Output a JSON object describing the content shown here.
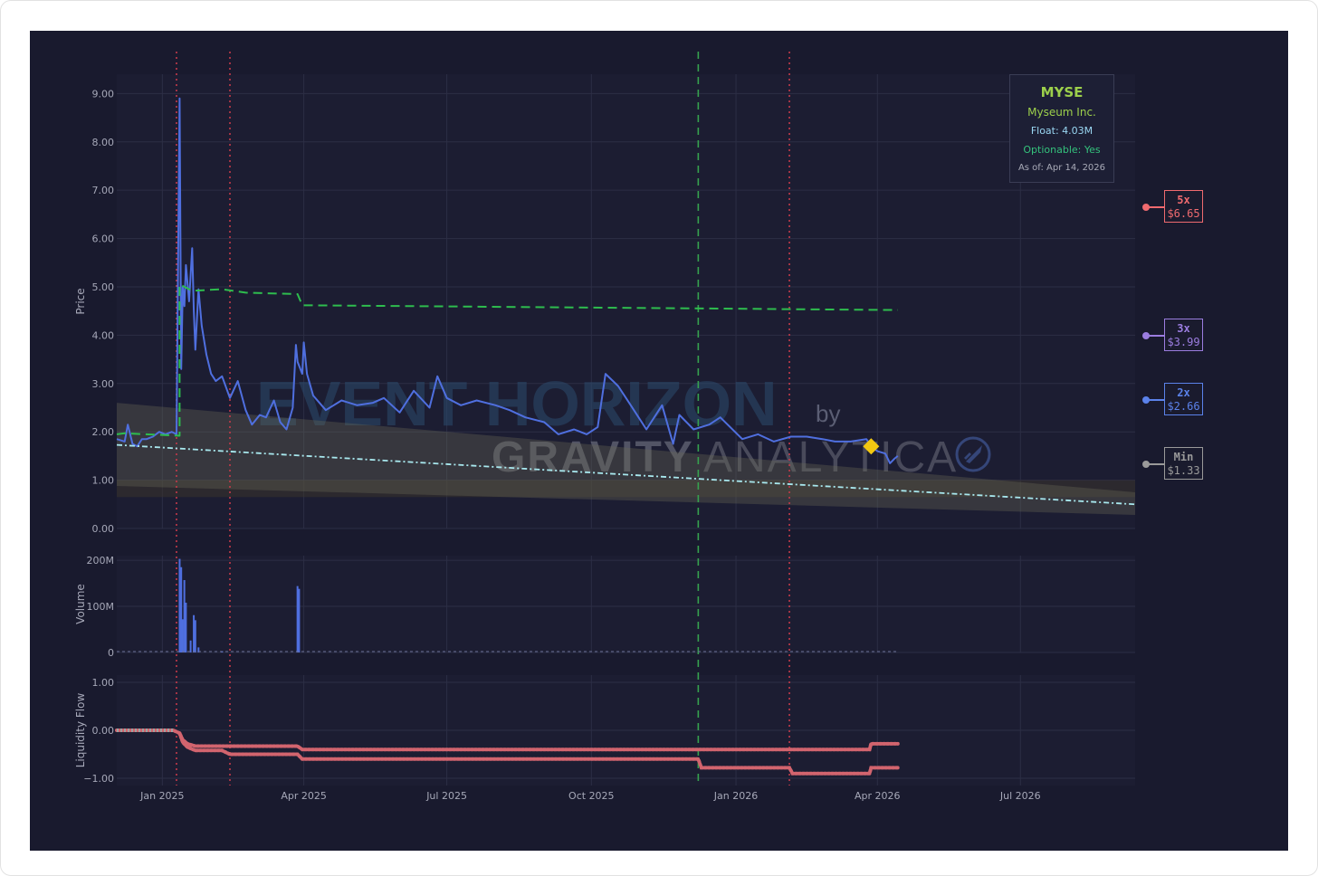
{
  "chart_data": {
    "type": "line",
    "ticker": "MYSE",
    "company": "Myseum Inc.",
    "float_text": "Float: 4.03M",
    "optionable_text": "Optionable: Yes",
    "as_of_text": "As of: Apr 14, 2026",
    "watermark": {
      "line1": "EVENT HORIZON",
      "by": "by",
      "line2a": "GRAVITY",
      "line2b": "ANALYTICA"
    },
    "x_ticks": [
      "Jan 2025",
      "Apr 2025",
      "Jul 2025",
      "Oct 2025",
      "Jan 2026",
      "Apr 2026",
      "Jul 2026"
    ],
    "x_tick_dates": [
      "2025-01-01",
      "2025-04-01",
      "2025-07-01",
      "2025-10-01",
      "2026-01-01",
      "2026-04-01",
      "2026-07-01"
    ],
    "x_range": [
      "2024-12-03",
      "2026-09-12"
    ],
    "panels": {
      "price": {
        "ylabel": "Price",
        "ylim": [
          0,
          9.4
        ],
        "y_ticks": [
          "0.00",
          "1.00",
          "2.00",
          "3.00",
          "4.00",
          "5.00",
          "6.00",
          "7.00",
          "8.00",
          "9.00"
        ],
        "series": [
          {
            "role": "price",
            "color": "#4f6fdf",
            "x": [
              "2024-12-03",
              "2024-12-08",
              "2024-12-10",
              "2024-12-13",
              "2024-12-16",
              "2024-12-19",
              "2024-12-22",
              "2024-12-26",
              "2024-12-30",
              "2025-01-03",
              "2025-01-07",
              "2025-01-10",
              "2025-01-12",
              "2025-01-13",
              "2025-01-14",
              "2025-01-15",
              "2025-01-16",
              "2025-01-18",
              "2025-01-20",
              "2025-01-21",
              "2025-01-22",
              "2025-01-24",
              "2025-01-26",
              "2025-01-29",
              "2025-02-01",
              "2025-02-04",
              "2025-02-08",
              "2025-02-13",
              "2025-02-18",
              "2025-02-23",
              "2025-02-27",
              "2025-03-04",
              "2025-03-08",
              "2025-03-13",
              "2025-03-17",
              "2025-03-21",
              "2025-03-25",
              "2025-03-27",
              "2025-03-28",
              "2025-03-31",
              "2025-04-01",
              "2025-04-03",
              "2025-04-07",
              "2025-04-15",
              "2025-04-25",
              "2025-05-05",
              "2025-05-15",
              "2025-05-22",
              "2025-06-01",
              "2025-06-10",
              "2025-06-20",
              "2025-06-25",
              "2025-07-01",
              "2025-07-10",
              "2025-07-20",
              "2025-08-01",
              "2025-08-10",
              "2025-08-20",
              "2025-09-01",
              "2025-09-10",
              "2025-09-20",
              "2025-09-28",
              "2025-10-05",
              "2025-10-10",
              "2025-10-18",
              "2025-10-25",
              "2025-11-05",
              "2025-11-15",
              "2025-11-22",
              "2025-11-26",
              "2025-12-05",
              "2025-12-15",
              "2025-12-22",
              "2026-01-05",
              "2026-01-15",
              "2026-01-25",
              "2026-02-05",
              "2026-02-15",
              "2026-02-25",
              "2026-03-05",
              "2026-03-15",
              "2026-03-25",
              "2026-03-28",
              "2026-04-01",
              "2026-04-06",
              "2026-04-09",
              "2026-04-12",
              "2026-04-14"
            ],
            "y": [
              1.85,
              1.8,
              2.15,
              1.75,
              1.7,
              1.85,
              1.85,
              1.9,
              2.0,
              1.95,
              2.0,
              1.95,
              8.9,
              3.3,
              5.0,
              4.6,
              5.45,
              4.7,
              5.8,
              4.5,
              3.7,
              4.95,
              4.2,
              3.6,
              3.2,
              3.05,
              3.15,
              2.7,
              3.05,
              2.45,
              2.15,
              2.35,
              2.3,
              2.65,
              2.2,
              2.05,
              2.5,
              3.8,
              3.45,
              3.2,
              3.85,
              3.2,
              2.75,
              2.45,
              2.65,
              2.55,
              2.6,
              2.7,
              2.4,
              2.85,
              2.5,
              3.15,
              2.7,
              2.55,
              2.65,
              2.55,
              2.45,
              2.3,
              2.2,
              1.95,
              2.05,
              1.95,
              2.1,
              3.2,
              2.95,
              2.6,
              2.05,
              2.55,
              1.75,
              2.35,
              2.05,
              2.15,
              2.3,
              1.85,
              1.95,
              1.8,
              1.9,
              1.9,
              1.85,
              1.8,
              1.8,
              1.85,
              1.7,
              1.6,
              1.55,
              1.35,
              1.45,
              1.5
            ]
          },
          {
            "role": "moving average",
            "color": "#2ebd4e",
            "x": [
              "2024-12-03",
              "2024-12-08",
              "2025-01-12",
              "2025-01-12",
              "2025-01-20",
              "2025-02-08",
              "2025-02-23",
              "2025-03-28",
              "2025-03-28",
              "2025-03-31",
              "2026-04-14"
            ],
            "y": [
              1.95,
              1.97,
              1.92,
              5.05,
              4.92,
              4.95,
              4.88,
              4.85,
              4.85,
              4.62,
              4.52
            ]
          },
          {
            "role": "trend",
            "color": "#a8e8ee",
            "x": [
              "2024-12-03",
              "2026-09-12"
            ],
            "y": [
              1.73,
              0.5
            ]
          }
        ],
        "band": {
          "color": "#6b6b55",
          "x": [
            "2024-12-03",
            "2026-09-12"
          ],
          "upper": [
            2.6,
            0.75
          ],
          "lower": [
            0.88,
            0.28
          ]
        },
        "horizontal_band": {
          "y": [
            0.65,
            1.0
          ],
          "color": "#3b362a"
        },
        "signal_marker": {
          "x": "2026-03-28",
          "y": 1.7,
          "color": "#f2c811",
          "shape": "diamond"
        }
      },
      "volume": {
        "ylabel": "Volume",
        "ylim": [
          0,
          210
        ],
        "y_ticks": [
          "0",
          "100M",
          "200M"
        ],
        "bars_millions": [
          {
            "x": "2025-01-12",
            "v": 203
          },
          {
            "x": "2025-01-13",
            "v": 185
          },
          {
            "x": "2025-01-14",
            "v": 72
          },
          {
            "x": "2025-01-15",
            "v": 157
          },
          {
            "x": "2025-01-16",
            "v": 108
          },
          {
            "x": "2025-01-19",
            "v": 26
          },
          {
            "x": "2025-01-21",
            "v": 81
          },
          {
            "x": "2025-01-22",
            "v": 70
          },
          {
            "x": "2025-01-24",
            "v": 11
          },
          {
            "x": "2025-02-08",
            "v": 3
          },
          {
            "x": "2025-03-28",
            "v": 144
          },
          {
            "x": "2025-03-29",
            "v": 138
          }
        ]
      },
      "liquidity": {
        "ylabel": "Liquidity Flow",
        "ylim": [
          -1.15,
          1.15
        ],
        "y_ticks": [
          "−1.00",
          "0.00",
          "1.00"
        ],
        "series": [
          {
            "role": "flow upper",
            "color": "#d2646e",
            "x": [
              "2024-12-03",
              "2025-01-08",
              "2025-01-12",
              "2025-01-14",
              "2025-01-17",
              "2025-01-22",
              "2025-02-05",
              "2025-03-28",
              "2025-03-31",
              "2026-03-27",
              "2026-03-28",
              "2026-04-14"
            ],
            "y": [
              0.0,
              0.0,
              -0.06,
              -0.2,
              -0.28,
              -0.33,
              -0.33,
              -0.33,
              -0.4,
              -0.4,
              -0.28,
              -0.28
            ]
          },
          {
            "role": "flow lower",
            "color": "#d2646e",
            "x": [
              "2025-01-12",
              "2025-01-14",
              "2025-01-17",
              "2025-01-22",
              "2025-02-08",
              "2025-02-13",
              "2025-03-28",
              "2025-03-31",
              "2025-12-08",
              "2025-12-10",
              "2026-02-04",
              "2026-02-06",
              "2026-03-27",
              "2026-03-28",
              "2026-04-14"
            ],
            "y": [
              -0.06,
              -0.25,
              -0.35,
              -0.42,
              -0.42,
              -0.5,
              -0.5,
              -0.6,
              -0.6,
              -0.78,
              -0.78,
              -0.9,
              -0.9,
              -0.78,
              -0.78
            ]
          }
        ]
      }
    },
    "vertical_markers": [
      {
        "x": "2025-01-10",
        "style": "dotted",
        "color": "#c43a4a"
      },
      {
        "x": "2025-02-13",
        "style": "dotted",
        "color": "#c43a4a"
      },
      {
        "x": "2025-12-08",
        "style": "dashed",
        "color": "#36a24f"
      },
      {
        "x": "2026-02-04",
        "style": "dotted",
        "color": "#c43a4a"
      }
    ],
    "price_targets": [
      {
        "label": "5x",
        "price_text": "$6.65",
        "value": 6.65,
        "color": "#ef6a6f"
      },
      {
        "label": "3x",
        "price_text": "$3.99",
        "value": 3.99,
        "color": "#9b7de0"
      },
      {
        "label": "2x",
        "price_text": "$2.66",
        "value": 2.66,
        "color": "#5b82ea"
      },
      {
        "label": "Min",
        "price_text": "$1.33",
        "value": 1.33,
        "color": "#9a9a9a"
      }
    ],
    "colors": {
      "background": "#191a2e",
      "grid": "#2c2e45",
      "ticker": "#9ccf4b",
      "company": "#9ccf4b",
      "float": "#9ad7f3",
      "optionable": "#34c27c",
      "as_of": "#a9abb8"
    }
  }
}
